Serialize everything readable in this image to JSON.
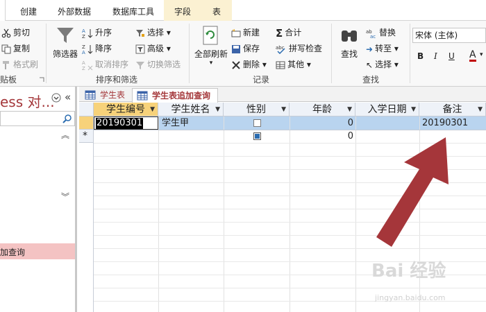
{
  "ribbon_tabs": [
    "创建",
    "外部数据",
    "数据库工具",
    "字段",
    "表"
  ],
  "ribbon": {
    "clipboard": {
      "cut": "剪切",
      "copy": "复制",
      "format_painter": "格式刷",
      "group_label": "贴板"
    },
    "sort_filter": {
      "filter": "筛选器",
      "ascending": "升序",
      "descending": "降序",
      "clear_sort": "取消排序",
      "selection": "选择",
      "advanced": "高级",
      "toggle_filter": "切换筛选",
      "group_label": "排序和筛选"
    },
    "records": {
      "refresh_all": "全部刷新",
      "new": "新建",
      "save": "保存",
      "delete": "删除",
      "totals": "合计",
      "spelling": "拼写检查",
      "more": "其他",
      "group_label": "记录"
    },
    "find": {
      "find": "查找",
      "replace": "替换",
      "goto": "转至",
      "select": "选择",
      "group_label": "查找"
    },
    "text": {
      "font": "宋体 (主体)",
      "bold": "B",
      "italic": "I",
      "underline": "U",
      "font_color": "A"
    }
  },
  "nav": {
    "title": "ess 对...",
    "item_label": "加查询"
  },
  "doc_tabs": [
    {
      "label": "学生表",
      "active": false
    },
    {
      "label": "学生表追加查询",
      "active": true
    }
  ],
  "columns": [
    "学生编号",
    "学生姓名",
    "性别",
    "年龄",
    "入学日期",
    "备注"
  ],
  "rows": [
    {
      "学生编号": "20190301",
      "学生姓名": "学生甲",
      "性别": false,
      "年龄": "0",
      "入学日期": "",
      "备注": "20190301"
    }
  ],
  "new_row": {
    "marker": "*",
    "年龄": "0"
  },
  "colors": {
    "accent": "#a4373a",
    "selected_row": "#b9d4ef",
    "header_selected": "#f7d27a",
    "arrow": "#a5363a"
  },
  "watermark": {
    "main": "Bai 经验",
    "sub": "jingyan.baidu.com"
  }
}
